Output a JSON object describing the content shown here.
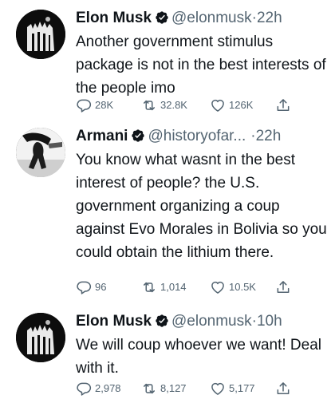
{
  "tweets": [
    {
      "avatar_icon": "profile-photo-icon",
      "name": "Elon Musk",
      "handle": "@elonmusk",
      "dot": "·",
      "time": "22h",
      "text": "Another government stimulus package is not in the best interests of the people imo",
      "replies": "28K",
      "retweets": "32.8K",
      "likes": "126K"
    },
    {
      "avatar_icon": "profile-photo-icon",
      "name": "Armani",
      "handle": "@historyofar...",
      "dot": "·",
      "time": "22h",
      "text": "You know what wasnt in the best interest of people? the U.S. government organizing a coup against Evo Morales in Bolivia so you could obtain the lithium there.",
      "replies": "96",
      "retweets": "1,014",
      "likes": "10.5K"
    },
    {
      "avatar_icon": "profile-photo-icon",
      "name": "Elon Musk",
      "handle": "@elonmusk",
      "dot": "·",
      "time": "10h",
      "text": "We will coup whoever we want! Deal with it.",
      "replies": "2,978",
      "retweets": "8,127",
      "likes": "5,177"
    }
  ],
  "icons": {
    "verified": "verified-badge-icon",
    "reply": "reply-icon",
    "retweet": "retweet-icon",
    "like": "heart-icon",
    "share": "share-icon"
  },
  "colors": {
    "text": "#0f1419",
    "secondary": "#536471",
    "verified_badge": "#0f1419"
  }
}
